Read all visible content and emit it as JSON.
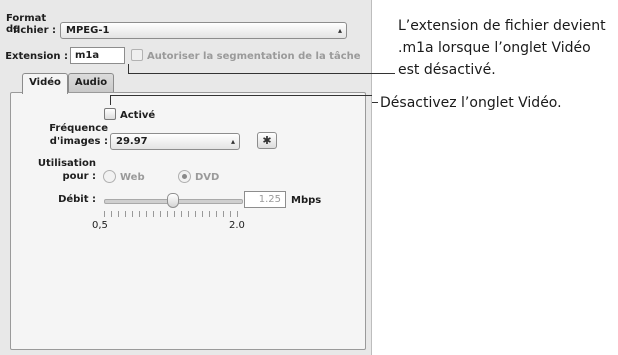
{
  "format": {
    "label_line1": "Format du",
    "label_line2": "fichier :",
    "value": "MPEG-1"
  },
  "extension": {
    "label": "Extension :",
    "value": "m1a",
    "segmentation_label": "Autoriser la segmentation de la tâche"
  },
  "tabs": [
    {
      "label": "Vidéo"
    },
    {
      "label": "Audio"
    }
  ],
  "video": {
    "enabled_label": "Activé",
    "framerate": {
      "label_line1": "Fréquence",
      "label_line2": "d'images :",
      "value": "29.97"
    },
    "usage": {
      "label_line1": "Utilisation",
      "label_line2": "pour :",
      "options": [
        "Web",
        "DVD"
      ],
      "selected": "DVD"
    },
    "bitrate": {
      "label": "Débit :",
      "value": "1.25",
      "unit": "Mbps",
      "min_label": "0,5",
      "max_label": "2.0",
      "min": 0.5,
      "max": 2.0
    }
  },
  "callouts": {
    "extension_line1": "L’extension de fichier devient",
    "extension_line2": ".m1a lorsque l’onglet Vidéo",
    "extension_line3": "est désactivé.",
    "video_tab": "Désactivez l’onglet Vidéo."
  }
}
